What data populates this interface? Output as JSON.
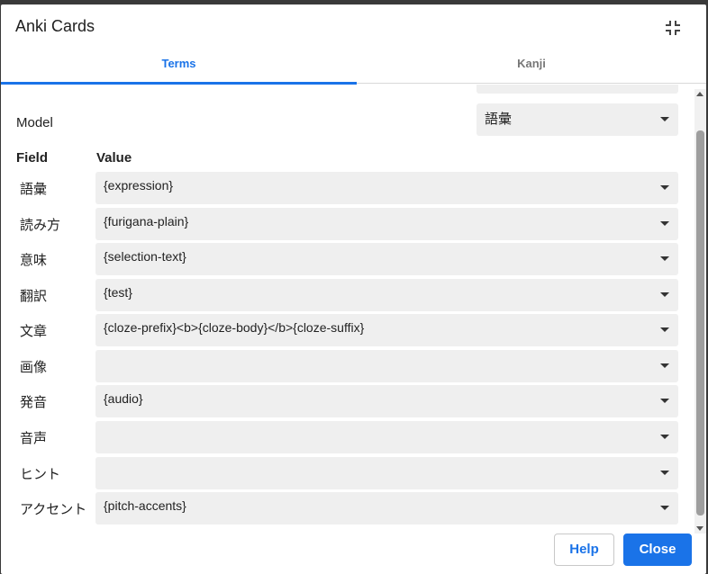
{
  "dialog": {
    "title": "Anki Cards",
    "collapse_icon": "collapse-icon"
  },
  "tabs": [
    {
      "label": "Terms",
      "active": true
    },
    {
      "label": "Kanji",
      "active": false
    }
  ],
  "model": {
    "label": "Model",
    "value": "語彙"
  },
  "table": {
    "field_header": "Field",
    "value_header": "Value",
    "rows": [
      {
        "field": "語彙",
        "value": "{expression}"
      },
      {
        "field": "読み方",
        "value": "{furigana-plain}"
      },
      {
        "field": "意味",
        "value": "{selection-text}"
      },
      {
        "field": "翻訳",
        "value": "{test}"
      },
      {
        "field": "文章",
        "value": "{cloze-prefix}<b>{cloze-body}</b>{cloze-suffix}"
      },
      {
        "field": "画像",
        "value": ""
      },
      {
        "field": "発音",
        "value": "{audio}"
      },
      {
        "field": "音声",
        "value": ""
      },
      {
        "field": "ヒント",
        "value": ""
      },
      {
        "field": "アクセント",
        "value": "{pitch-accents}"
      }
    ]
  },
  "footer": {
    "help_label": "Help",
    "close_label": "Close"
  },
  "colors": {
    "accent": "#1a73e8",
    "select_bg": "#efefef"
  }
}
